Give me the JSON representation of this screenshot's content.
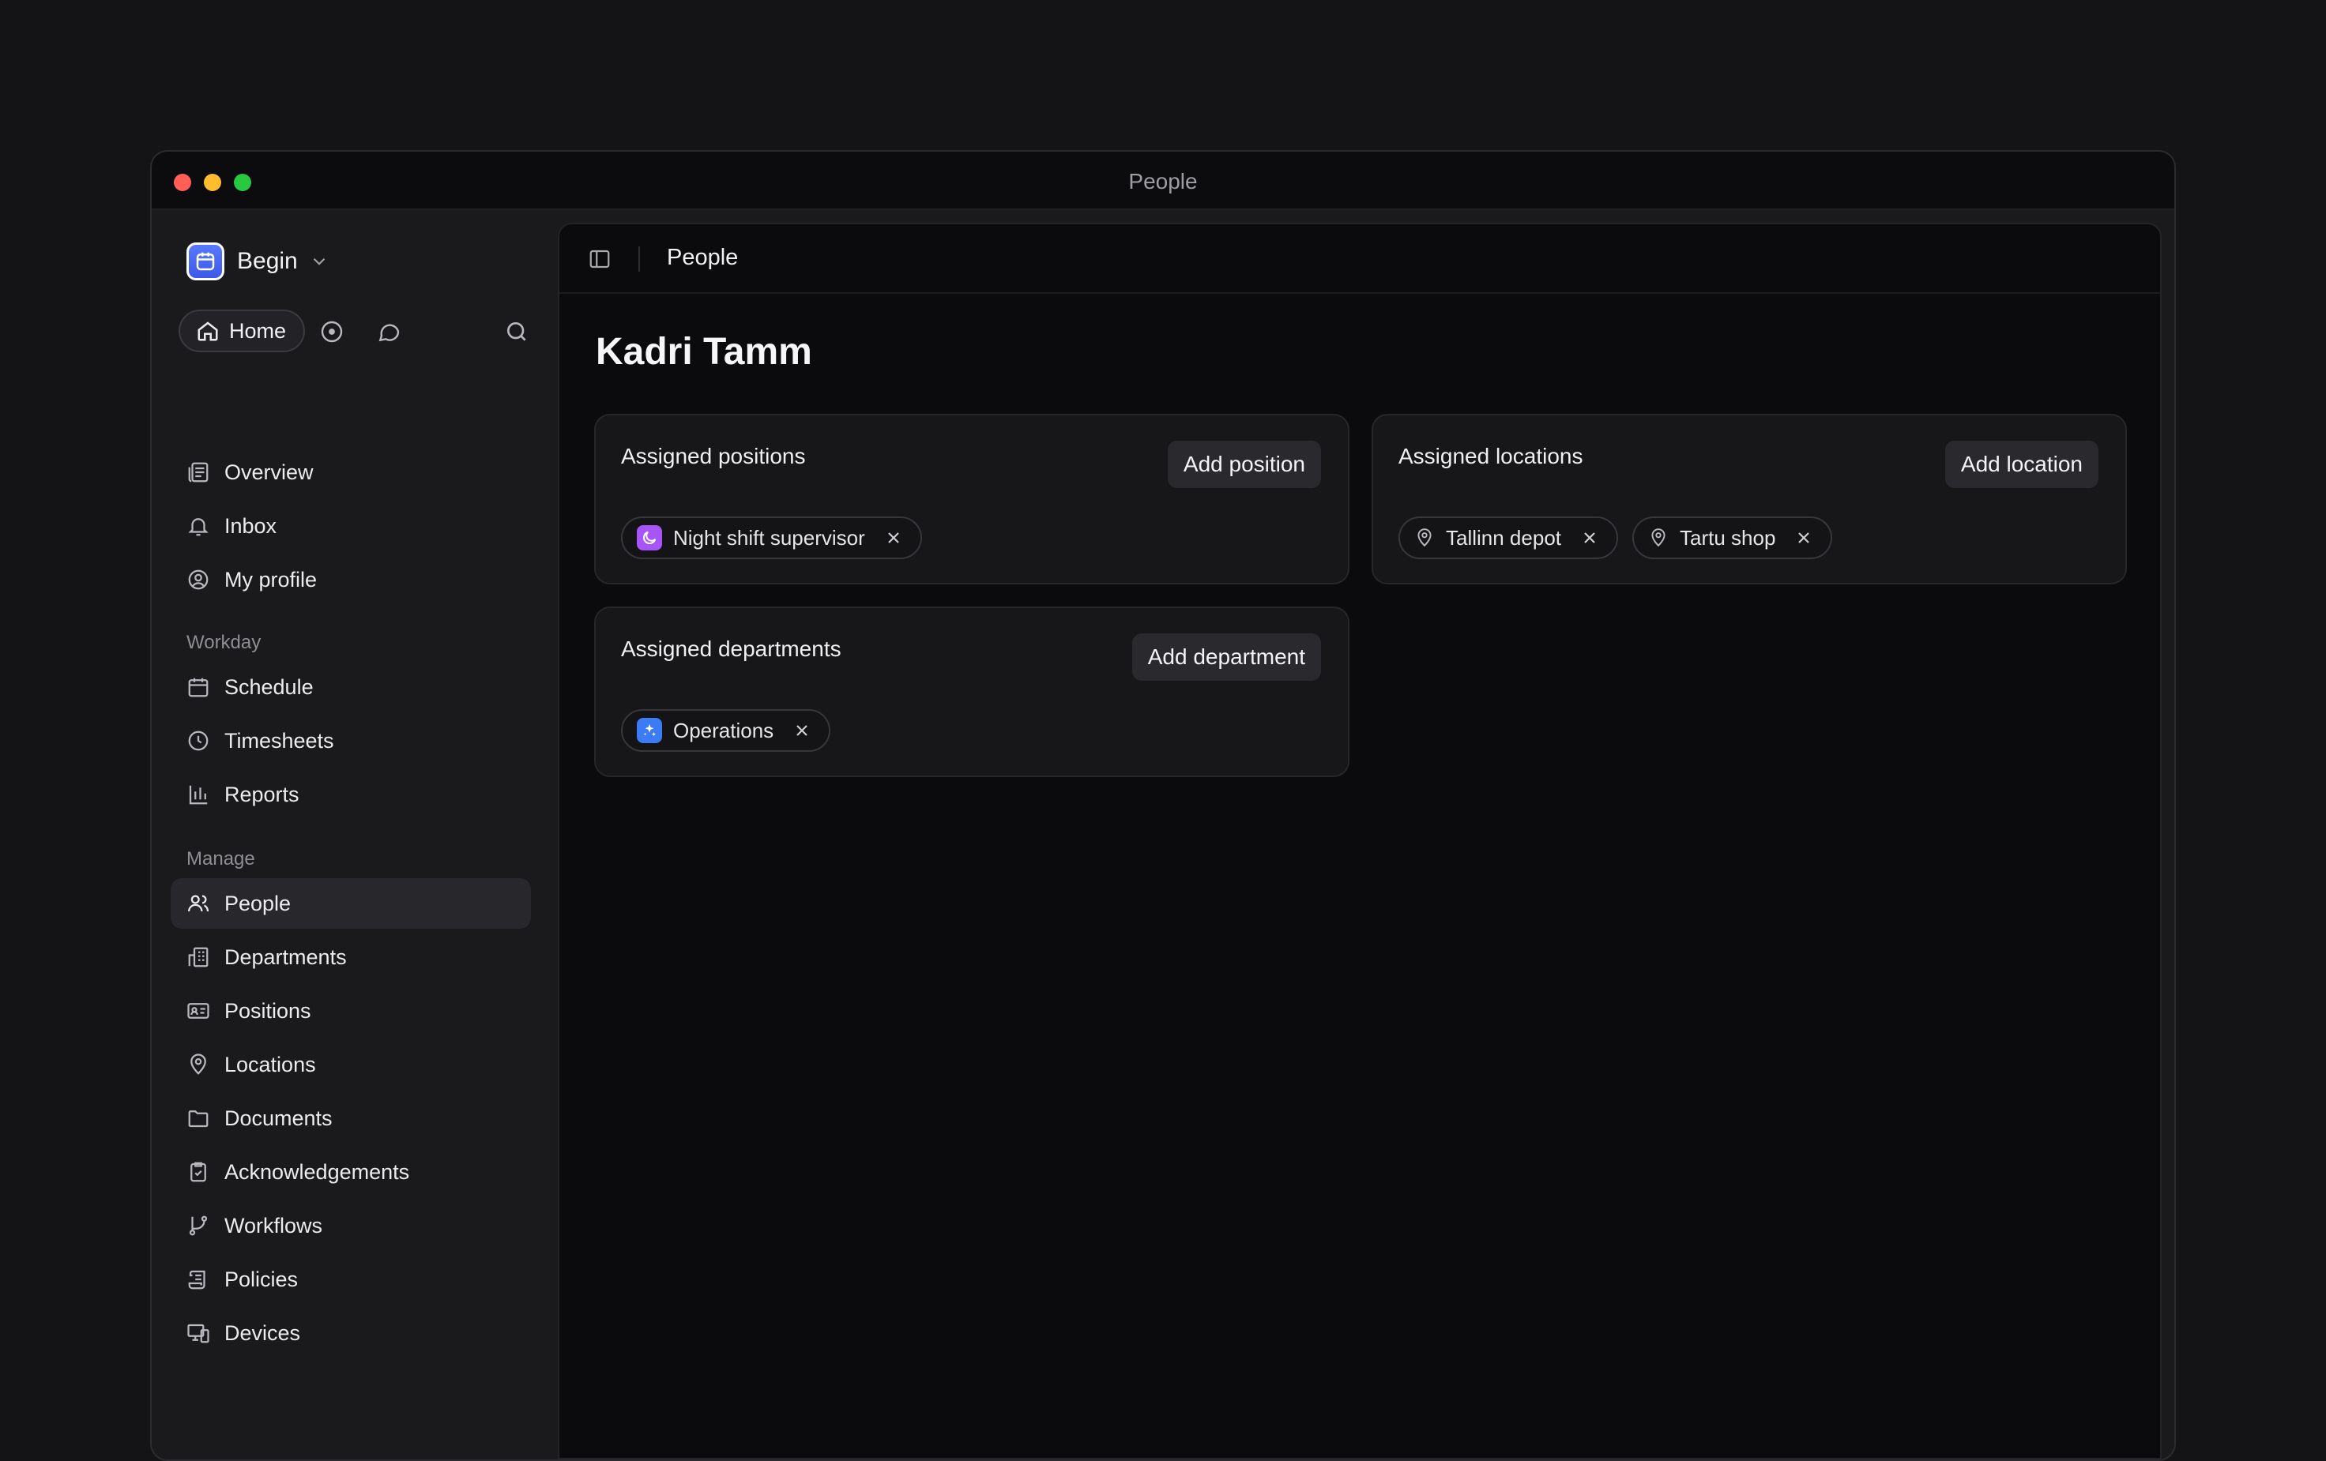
{
  "window": {
    "title": "People"
  },
  "sidebar": {
    "workspace": "Begin",
    "quick": {
      "home_label": "Home"
    },
    "items_main": [
      {
        "label": "Overview",
        "icon": "overview-icon"
      },
      {
        "label": "Inbox",
        "icon": "bell-icon"
      },
      {
        "label": "My profile",
        "icon": "user-circle-icon"
      }
    ],
    "section_workday": "Workday",
    "items_workday": [
      {
        "label": "Schedule",
        "icon": "calendar-icon"
      },
      {
        "label": "Timesheets",
        "icon": "clock-icon"
      },
      {
        "label": "Reports",
        "icon": "bar-chart-icon"
      }
    ],
    "section_manage": "Manage",
    "items_manage": [
      {
        "label": "People",
        "icon": "people-icon",
        "active": true
      },
      {
        "label": "Departments",
        "icon": "building-icon"
      },
      {
        "label": "Positions",
        "icon": "id-card-icon"
      },
      {
        "label": "Locations",
        "icon": "map-pin-icon"
      },
      {
        "label": "Documents",
        "icon": "folder-icon"
      },
      {
        "label": "Acknowledgements",
        "icon": "clipboard-check-icon"
      },
      {
        "label": "Workflows",
        "icon": "git-branch-icon"
      },
      {
        "label": "Policies",
        "icon": "scroll-icon"
      },
      {
        "label": "Devices",
        "icon": "devices-icon"
      }
    ]
  },
  "header": {
    "title": "People"
  },
  "main": {
    "person_name": "Kadri Tamm",
    "positions": {
      "title": "Assigned positions",
      "button": "Add position",
      "chips": [
        {
          "label": "Night shift supervisor",
          "badge_color": "#a855f7",
          "icon": "moon-icon"
        }
      ]
    },
    "locations": {
      "title": "Assigned locations",
      "button": "Add location",
      "chips": [
        {
          "label": "Tallinn depot",
          "icon": "map-pin-icon"
        },
        {
          "label": "Tartu shop",
          "icon": "map-pin-icon"
        }
      ]
    },
    "departments": {
      "title": "Assigned departments",
      "button": "Add department",
      "chips": [
        {
          "label": "Operations",
          "badge_color": "#3b7cf6",
          "icon": "sparkles-icon"
        }
      ]
    }
  },
  "colors": {
    "accent": "#4a67f5",
    "background": "#0b0b0d",
    "sidebar": "#1a1a1d"
  }
}
